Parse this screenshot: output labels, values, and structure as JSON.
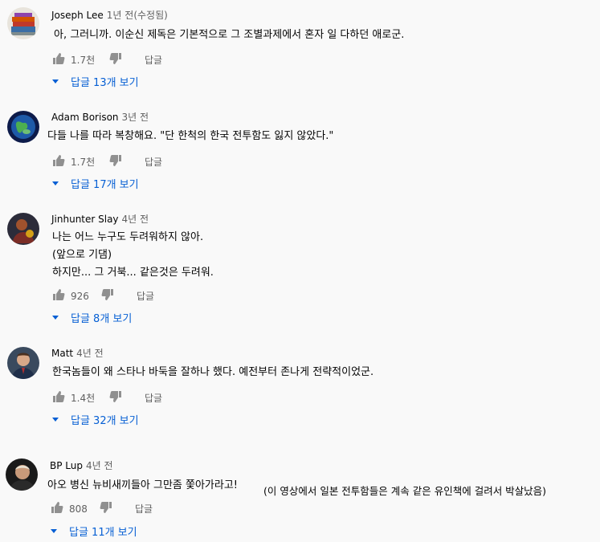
{
  "colors": {
    "link": "#065fd4",
    "muted": "#606060",
    "text": "#030303",
    "background": "#f9f9f9"
  },
  "icons": {
    "like": "thumb-up-icon",
    "dislike": "thumb-down-icon",
    "expand": "caret-down-icon"
  },
  "comments": [
    {
      "author": "Joseph Lee",
      "time": "1년 전(수정됨)",
      "lines": [
        "아, 그러니까. 이순신 제독은 기본적으로 그 조별과제에서 혼자 일 다하던 애로군."
      ],
      "likes": "1.7천",
      "reply_label": "답글",
      "replies_label": "답글 13개 보기"
    },
    {
      "author": "Adam Borison",
      "time": "3년 전",
      "lines": [
        "다들 나를 따라 복창해요. \"단 한척의 한국 전투함도 잃지 않았다.\""
      ],
      "likes": "1.7천",
      "reply_label": "답글",
      "replies_label": "답글 17개 보기"
    },
    {
      "author": "Jinhunter Slay",
      "time": "4년 전",
      "lines": [
        "나는 어느 누구도 두려워하지 않아.",
        "(앞으로 기댐)",
        "하지만... 그 거북... 같은것은 두려워."
      ],
      "likes": "926",
      "reply_label": "답글",
      "replies_label": "답글 8개 보기"
    },
    {
      "author": "Matt",
      "time": "4년 전",
      "lines": [
        "한국놈들이 왜 스타나 바둑을 잘하나 했다. 예전부터 존나게 전략적이었군."
      ],
      "likes": "1.4천",
      "reply_label": "답글",
      "replies_label": "답글 32개 보기"
    },
    {
      "author": "BP Lup",
      "time": "4년 전",
      "lines": [
        "아오 병신 뉴비새끼들아 그만좀 쫓아가라고!"
      ],
      "note": "(이 영상에서 일본 전투함들은 계속 같은 유인책에 걸려서 박살났음)",
      "likes": "808",
      "reply_label": "답글",
      "replies_label": "답글 11개 보기"
    }
  ]
}
